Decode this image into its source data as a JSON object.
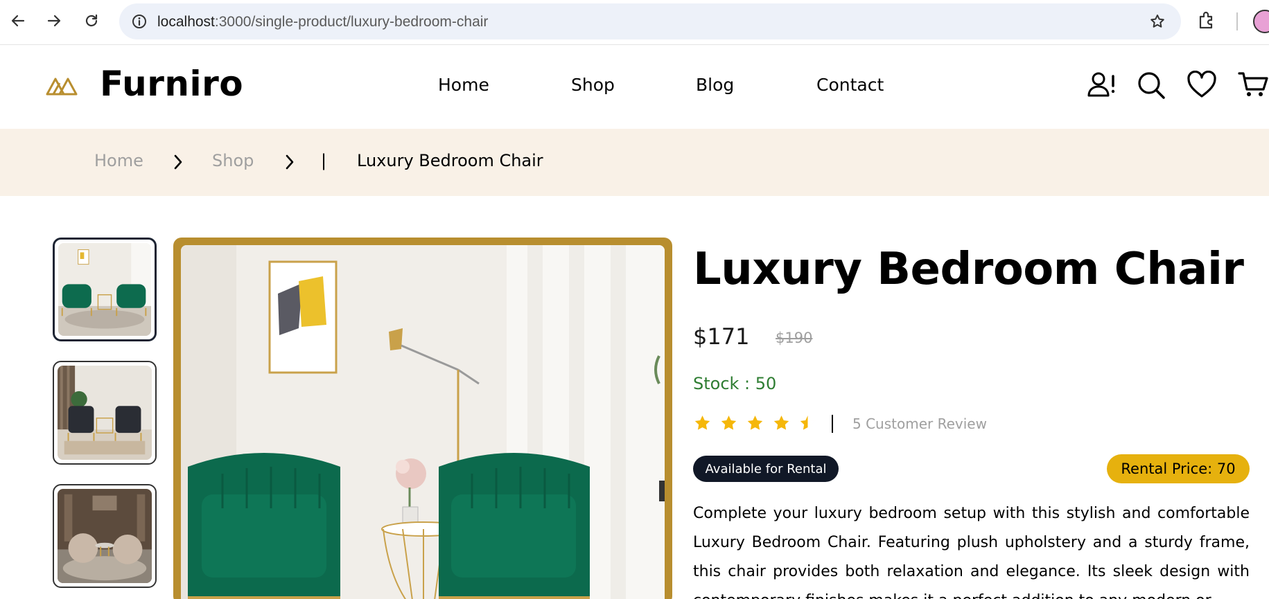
{
  "browser": {
    "url_host": "localhost",
    "url_path": ":3000/single-product/luxury-bedroom-chair"
  },
  "header": {
    "brand": "Furniro",
    "nav": [
      "Home",
      "Shop",
      "Blog",
      "Contact"
    ],
    "icons": [
      "account-alert-icon",
      "search-icon",
      "heart-icon",
      "cart-icon"
    ]
  },
  "breadcrumb": {
    "items": [
      "Home",
      "Shop"
    ],
    "separator": "|",
    "current": "Luxury Bedroom Chair"
  },
  "product": {
    "title": "Luxury Bedroom Chair",
    "price": "$171",
    "old_price": "$190",
    "stock": "Stock : 50",
    "rating": 4.5,
    "review_text": "5 Customer Review",
    "rental_badge": "Available for Rental",
    "rental_price": "Rental Price: 70",
    "description": "Complete your luxury bedroom setup with this stylish and comfortable Luxury Bedroom Chair. Featuring plush upholstery and a sturdy frame, this chair provides both relaxation and elegance. Its sleek design with contemporary finishes makes it a perfect addition to any modern or"
  },
  "colors": {
    "accent": "#b88e2f",
    "breadcrumb_bg": "#f9f1e7",
    "stock_green": "#2e7d32",
    "star": "#f5b70a",
    "rental_price_bg": "#e6b10e",
    "rental_badge_bg": "#111827"
  }
}
